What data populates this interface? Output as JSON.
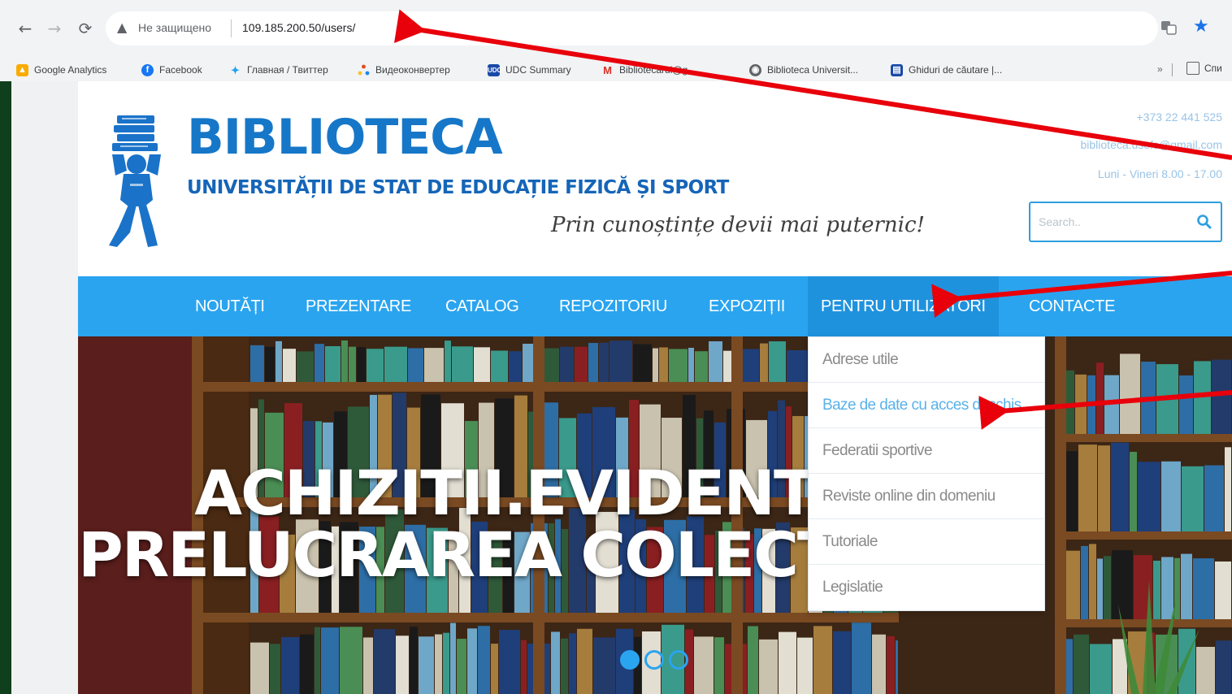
{
  "browser": {
    "security_label": "Не защищено",
    "url": "109.185.200.50/users/",
    "bookmarks": [
      {
        "label": "Google Analytics",
        "icon": "analytics-icon",
        "color": "#f9ab00"
      },
      {
        "label": "Facebook",
        "icon": "facebook-icon",
        "color": "#1877f2"
      },
      {
        "label": "Главная / Твиттер",
        "icon": "twitter-icon",
        "color": "#1da1f2"
      },
      {
        "label": "Видеоконвертер",
        "icon": "video-icon",
        "color": "#e64a19"
      },
      {
        "label": "UDC Summary",
        "icon": "udc-icon",
        "color": "#1a4aa8"
      },
      {
        "label": "Bibliotecarul@g...",
        "icon": "gmail-icon",
        "color": "#d93025"
      },
      {
        "label": "Biblioteca Universit...",
        "icon": "globe-icon",
        "color": "#5f6368"
      },
      {
        "label": "Ghiduri de căutare |...",
        "icon": "book-icon",
        "color": "#1a4aa8"
      }
    ],
    "more_label": "»",
    "other_bookmarks_label": "Спи"
  },
  "site": {
    "title": "BIBLIOTECA",
    "subtitle": "UNIVERSITĂȚII DE STAT DE EDUCAȚIE FIZICĂ ȘI SPORT",
    "motto": "Prin cunoștințe devii mai puternic!",
    "phone": "+373 22 441 525",
    "email": "biblioteca.usefs@gmail.com",
    "hours": "Luni - Vineri 8.00 - 17.00",
    "search_placeholder": "Search..",
    "accent_color": "#2aa4ef"
  },
  "nav": {
    "items": [
      {
        "label": "NOUTĂȚI"
      },
      {
        "label": "PREZENTARE"
      },
      {
        "label": "CATALOG"
      },
      {
        "label": "REPOZITORIU"
      },
      {
        "label": "EXPOZIȚII"
      },
      {
        "label": "PENTRU UTILIZATORI",
        "active": true
      },
      {
        "label": "CONTACTE"
      }
    ]
  },
  "dropdown": {
    "items": [
      {
        "label": "Adrese utile"
      },
      {
        "label": "Baze de date cu acces deschis",
        "highlighted": true
      },
      {
        "label": "Federatii sportive"
      },
      {
        "label": "Reviste online din domeniu"
      },
      {
        "label": "Tutoriale"
      },
      {
        "label": "Legislatie"
      }
    ]
  },
  "hero": {
    "line1": "ACHIZITII.EVIDENTA",
    "line2": "PRELUCRAREA COLECȚIILOR",
    "slides": 3,
    "active_slide": 1
  },
  "annotation": {
    "arrow_color": "#e8000b"
  }
}
